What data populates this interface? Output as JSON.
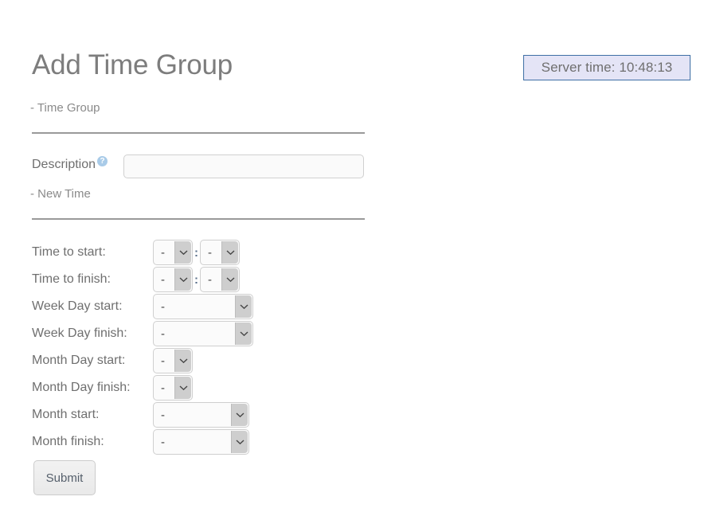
{
  "page": {
    "title": "Add Time Group"
  },
  "server_time": {
    "label": "Server time: 10:48:13",
    "background_color": "#e4e4f6",
    "border_color": "#3f6fa5"
  },
  "sections": [
    {
      "label": "- Time Group"
    },
    {
      "label": "- New Time"
    }
  ],
  "description": {
    "label": "Description",
    "help_icon": "question-mark-icon",
    "value": "",
    "placeholder": ""
  },
  "fields": [
    {
      "label": "Time to start:",
      "type": "time",
      "hour": "-",
      "minute": "-",
      "separator": ":"
    },
    {
      "label": "Time to finish:",
      "type": "time",
      "hour": "-",
      "minute": "-",
      "separator": ":"
    },
    {
      "label": "Week Day start:",
      "type": "wide",
      "value": "-"
    },
    {
      "label": "Week Day finish:",
      "type": "wide",
      "value": "-"
    },
    {
      "label": "Month Day start:",
      "type": "small",
      "value": "-"
    },
    {
      "label": "Month Day finish:",
      "type": "small",
      "value": "-"
    },
    {
      "label": "Month start:",
      "type": "mid",
      "value": "-"
    },
    {
      "label": "Month finish:",
      "type": "mid",
      "value": "-"
    }
  ],
  "submit": {
    "label": "Submit"
  }
}
